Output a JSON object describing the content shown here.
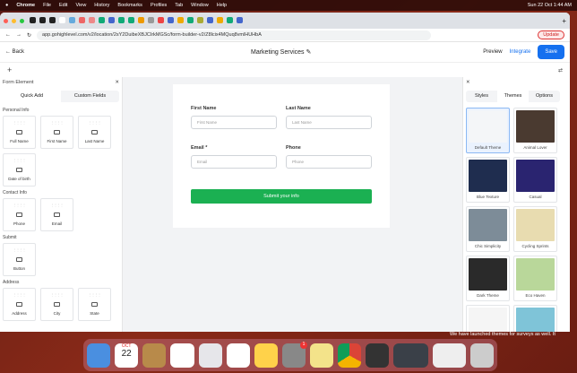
{
  "menubar": {
    "app": "Chrome",
    "items": [
      "File",
      "Edit",
      "View",
      "History",
      "Bookmarks",
      "Profiles",
      "Tab",
      "Window",
      "Help"
    ],
    "datetime": "Sun 22 Oct  1:44 AM"
  },
  "browser": {
    "url": "app.gohighlevel.com/v2/location/2sY2DuibeXBJCIrkMGSc/form-builder-v2/Z8lcix4MQuq8vmlHUHbA",
    "update_label": "Update"
  },
  "header": {
    "back": "Back",
    "title": "Marketing Services",
    "preview": "Preview",
    "integrate": "Integrate",
    "save": "Save"
  },
  "left_panel": {
    "title": "Form Element",
    "tabs": [
      "Quick Add",
      "Custom Fields"
    ],
    "sections": [
      {
        "title": "Personal Info",
        "items": [
          "Full Name",
          "First Name",
          "Last Name",
          "Date of birth"
        ]
      },
      {
        "title": "Contact Info",
        "items": [
          "Phone",
          "Email"
        ]
      },
      {
        "title": "Submit",
        "items": [
          "Button"
        ]
      },
      {
        "title": "Address",
        "items": [
          "Address",
          "City",
          "State"
        ]
      }
    ]
  },
  "form": {
    "first_name_label": "First Name",
    "first_name_placeholder": "First Name",
    "last_name_label": "Last Name",
    "last_name_placeholder": "Last Name",
    "email_label": "Email *",
    "email_placeholder": "Email",
    "phone_label": "Phone",
    "phone_placeholder": "Phone",
    "submit": "Submit your info",
    "submit_color": "#1bb052"
  },
  "right_panel": {
    "tabs": [
      "Styles",
      "Themes",
      "Options"
    ],
    "active_tab": "Themes",
    "themes": [
      {
        "name": "Default Theme",
        "color": "#f4f6f8"
      },
      {
        "name": "Animal Lover",
        "color": "#4a3a30"
      },
      {
        "name": "Blue Texture",
        "color": "#1f2d4f"
      },
      {
        "name": "Casual",
        "color": "#2a2470"
      },
      {
        "name": "Chic Simplicity",
        "color": "#7d8c98"
      },
      {
        "name": "Cycling Sprints",
        "color": "#e8dcb0"
      },
      {
        "name": "Dark Theme",
        "color": "#2a2a2a"
      },
      {
        "name": "Eco Haven",
        "color": "#b9d79a"
      },
      {
        "name": "",
        "color": "#f5f5f5"
      },
      {
        "name": "",
        "color": "#7fc4d8"
      }
    ]
  },
  "notification": {
    "text": "We have launched themes for surveys as well. It"
  },
  "dock": {
    "calendar_month": "OCT",
    "calendar_day": "22",
    "badge": "1"
  }
}
